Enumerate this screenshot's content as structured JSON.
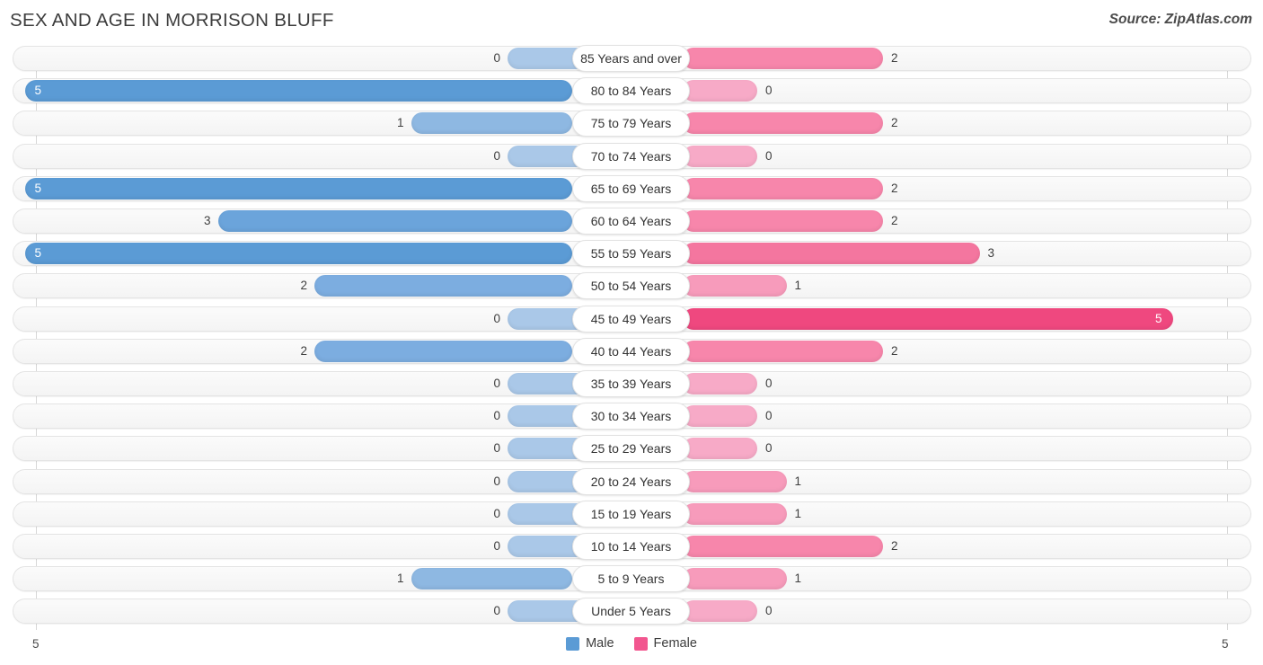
{
  "header": {
    "title": "SEX AND AGE IN MORRISON BLUFF",
    "source": "Source: ZipAtlas.com"
  },
  "legend": {
    "male_label": "Male",
    "female_label": "Female",
    "male_color": "#5b9bd5",
    "female_color": "#f2568f"
  },
  "axis": {
    "left_tick": "5",
    "right_tick": "5",
    "max": 5
  },
  "chart_data": {
    "type": "bar",
    "subtype": "population-pyramid",
    "title": "SEX AND AGE IN MORRISON BLUFF",
    "xlabel": "",
    "ylabel": "",
    "xlim": [
      5,
      5
    ],
    "grid": false,
    "legend_position": "bottom-center",
    "categories": [
      "85 Years and over",
      "80 to 84 Years",
      "75 to 79 Years",
      "70 to 74 Years",
      "65 to 69 Years",
      "60 to 64 Years",
      "55 to 59 Years",
      "50 to 54 Years",
      "45 to 49 Years",
      "40 to 44 Years",
      "35 to 39 Years",
      "30 to 34 Years",
      "25 to 29 Years",
      "20 to 24 Years",
      "15 to 19 Years",
      "10 to 14 Years",
      "5 to 9 Years",
      "Under 5 Years"
    ],
    "series": [
      {
        "name": "Male",
        "values": [
          0,
          5,
          1,
          0,
          5,
          3,
          5,
          2,
          0,
          2,
          0,
          0,
          0,
          0,
          0,
          0,
          1,
          0
        ]
      },
      {
        "name": "Female",
        "values": [
          2,
          0,
          2,
          0,
          2,
          2,
          3,
          1,
          5,
          2,
          0,
          0,
          0,
          1,
          1,
          2,
          1,
          0
        ]
      }
    ]
  },
  "rows": [
    {
      "label": "85 Years and over",
      "male": "0",
      "female": "2"
    },
    {
      "label": "80 to 84 Years",
      "male": "5",
      "female": "0"
    },
    {
      "label": "75 to 79 Years",
      "male": "1",
      "female": "2"
    },
    {
      "label": "70 to 74 Years",
      "male": "0",
      "female": "0"
    },
    {
      "label": "65 to 69 Years",
      "male": "5",
      "female": "2"
    },
    {
      "label": "60 to 64 Years",
      "male": "3",
      "female": "2"
    },
    {
      "label": "55 to 59 Years",
      "male": "5",
      "female": "3"
    },
    {
      "label": "50 to 54 Years",
      "male": "2",
      "female": "1"
    },
    {
      "label": "45 to 49 Years",
      "male": "0",
      "female": "5"
    },
    {
      "label": "40 to 44 Years",
      "male": "2",
      "female": "2"
    },
    {
      "label": "35 to 39 Years",
      "male": "0",
      "female": "0"
    },
    {
      "label": "30 to 34 Years",
      "male": "0",
      "female": "0"
    },
    {
      "label": "25 to 29 Years",
      "male": "0",
      "female": "0"
    },
    {
      "label": "20 to 24 Years",
      "male": "0",
      "female": "1"
    },
    {
      "label": "15 to 19 Years",
      "male": "0",
      "female": "1"
    },
    {
      "label": "10 to 14 Years",
      "male": "0",
      "female": "2"
    },
    {
      "label": "5 to 9 Years",
      "male": "1",
      "female": "1"
    },
    {
      "label": "Under 5 Years",
      "male": "0",
      "female": "0"
    }
  ]
}
